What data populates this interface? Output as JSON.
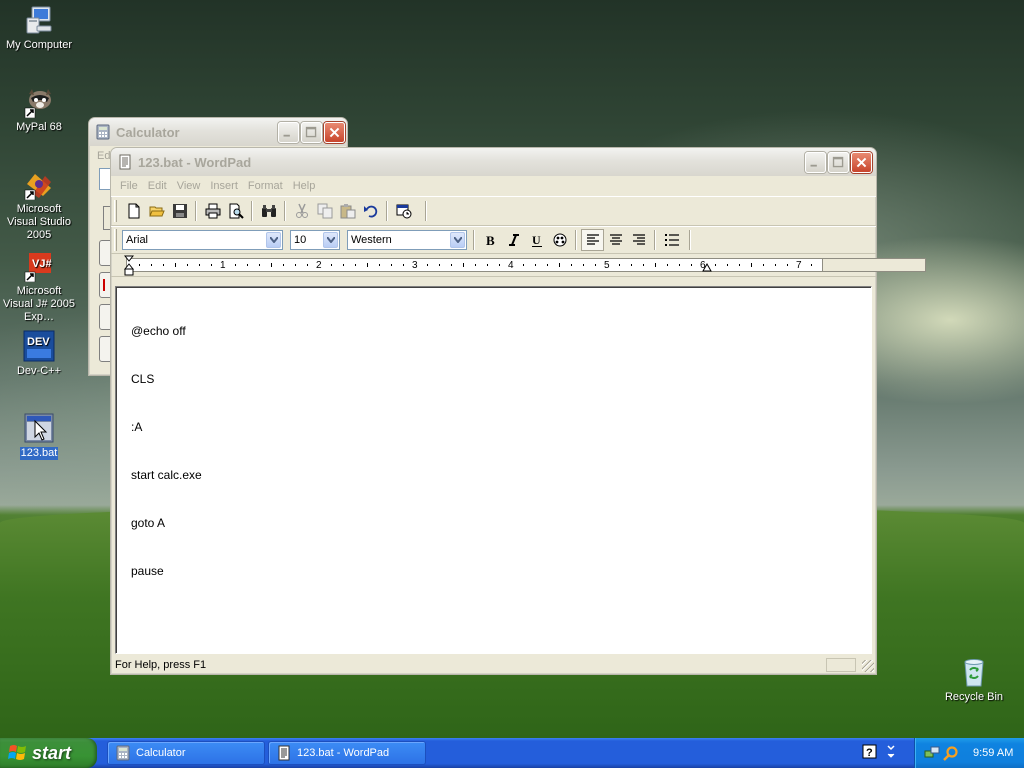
{
  "desktop": {
    "icons": [
      {
        "label": "My Computer",
        "icon": "my-computer-icon"
      },
      {
        "label": "MyPal 68",
        "icon": "mypal-icon"
      },
      {
        "label": "Microsoft Visual Studio 2005",
        "icon": "visual-studio-icon"
      },
      {
        "label": "Microsoft Visual J# 2005 Exp…",
        "icon": "visual-jsharp-icon"
      },
      {
        "label": "Dev-C++",
        "icon": "devcpp-icon"
      },
      {
        "label": "123.bat",
        "icon": "batch-file-icon"
      },
      {
        "label": "Recycle Bin",
        "icon": "recycle-bin-icon"
      }
    ]
  },
  "calculator": {
    "title": "Calculator",
    "menu_fragment": "Ed"
  },
  "wordpad": {
    "title": "123.bat - WordPad",
    "menu": [
      "File",
      "Edit",
      "View",
      "Insert",
      "Format",
      "Help"
    ],
    "format_bar": {
      "font": "Arial",
      "size": "10",
      "script": "Western"
    },
    "ruler_numbers": [
      "1",
      "2",
      "3",
      "4",
      "5",
      "6",
      "7"
    ],
    "document_lines": [
      "@echo off",
      "CLS",
      ":A",
      "start calc.exe",
      "goto A",
      "pause"
    ],
    "status_text": "For Help, press F1"
  },
  "taskbar": {
    "start_label": "start",
    "tasks": [
      {
        "label": "Calculator"
      },
      {
        "label": "123.bat - WordPad"
      }
    ],
    "clock": "9:59 AM"
  },
  "colors": {
    "taskbar_blue": "#245edb",
    "start_green": "#389334",
    "tray_blue": "#0f83e0",
    "selection_blue": "#316ac5"
  }
}
